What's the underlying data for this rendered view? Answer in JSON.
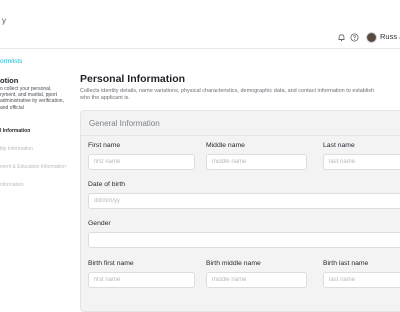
{
  "header": {
    "brand_fragment": "y",
    "user_name": "Russ Je"
  },
  "sidebar": {
    "back_link": "ormlists",
    "title": "otion",
    "description": "o collect your personal, ryment, and marital, pport administrative ity verification, and official",
    "steps": [
      {
        "label": "l Information",
        "active": true
      },
      {
        "label": "tity Information",
        "active": false
      },
      {
        "label": "ment & Education Information",
        "active": false
      },
      {
        "label": "nformation",
        "active": false
      }
    ]
  },
  "main": {
    "title": "Personal Information",
    "description": "Collects identity details, name variations, physical characteristics, demographic data, and contact information to establish who the applicant is.",
    "card_title": "General Information",
    "fields": {
      "first_name": {
        "label": "First name",
        "placeholder": "first name"
      },
      "middle_name": {
        "label": "Middle name",
        "placeholder": "middle name"
      },
      "last_name": {
        "label": "Last name",
        "placeholder": "last name"
      },
      "dob": {
        "label": "Date of birth",
        "placeholder": "dd/mm/yy"
      },
      "gender": {
        "label": "Gender",
        "placeholder": ""
      },
      "birth_first_name": {
        "label": "Birth first name",
        "placeholder": "first name"
      },
      "birth_middle_name": {
        "label": "Birth middle name",
        "placeholder": "middle name"
      },
      "birth_last_name": {
        "label": "Birth last name",
        "placeholder": "last name"
      }
    }
  },
  "colors": {
    "accent": "#1fb3c8",
    "card_bg": "#f3f3f4"
  },
  "icons": [
    "bell-icon",
    "help-circle-icon"
  ]
}
